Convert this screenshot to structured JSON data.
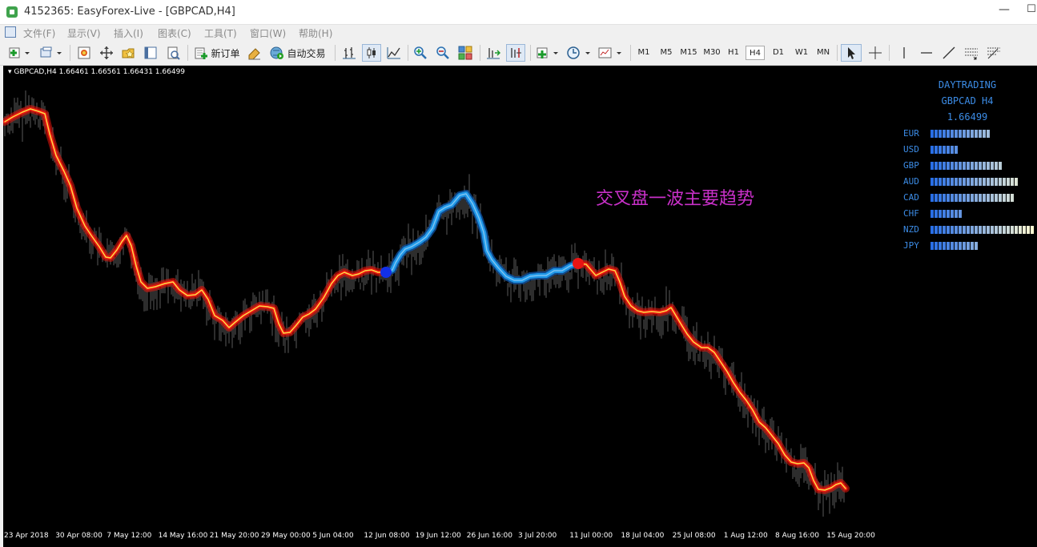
{
  "window": {
    "title": "4152365: EasyForex-Live - [GBPCAD,H4]",
    "min_glyph": "—",
    "max_glyph": "☐"
  },
  "menu": {
    "items": [
      {
        "label": "文件(F)"
      },
      {
        "label": "显示(V)"
      },
      {
        "label": "插入(I)"
      },
      {
        "label": "图表(C)"
      },
      {
        "label": "工具(T)"
      },
      {
        "label": "窗口(W)"
      },
      {
        "label": "帮助(H)"
      }
    ]
  },
  "toolbar": {
    "new_order_label": "新订单",
    "auto_trading_label": "自动交易",
    "timeframes": [
      "M1",
      "M5",
      "M15",
      "M30",
      "H1",
      "H4",
      "D1",
      "W1",
      "MN"
    ],
    "active_timeframe": "H4"
  },
  "chart": {
    "symbol_info": "GBPCAD,H4  1.66461 1.66561 1.66431 1.66499",
    "annotation": "交叉盘一波主要趋势",
    "x_ticks": [
      "23 Apr 2018",
      "30 Apr 08:00",
      "7 May 12:00",
      "14 May 16:00",
      "21 May 20:00",
      "29 May 00:00",
      "5 Jun 04:00",
      "12 Jun 08:00",
      "19 Jun 12:00",
      "26 Jun 16:00",
      "3 Jul 20:00",
      "11 Jul 00:00",
      "18 Jul 04:00",
      "25 Jul 08:00",
      "1 Aug 12:00",
      "8 Aug 16:00",
      "15 Aug 20:00"
    ],
    "colors": {
      "background": "#000000",
      "downtrend": "#e8150c",
      "downtrend_core": "#ffd84a",
      "uptrend": "#1e96e6",
      "start_marker": "#1230e8",
      "end_marker": "#e81414",
      "panel_text": "#3c8ce6",
      "annotation": "#c830c8"
    },
    "strength_panel": {
      "title": "DAYTRADING",
      "symbol_tf": "GBPCAD H4",
      "price": "1.66499",
      "currencies": [
        {
          "code": "EUR",
          "level": 15
        },
        {
          "code": "USD",
          "level": 7
        },
        {
          "code": "GBP",
          "level": 18
        },
        {
          "code": "AUD",
          "level": 22
        },
        {
          "code": "CAD",
          "level": 21
        },
        {
          "code": "CHF",
          "level": 8
        },
        {
          "code": "NZD",
          "level": 26
        },
        {
          "code": "JPY",
          "level": 12
        }
      ]
    }
  }
}
